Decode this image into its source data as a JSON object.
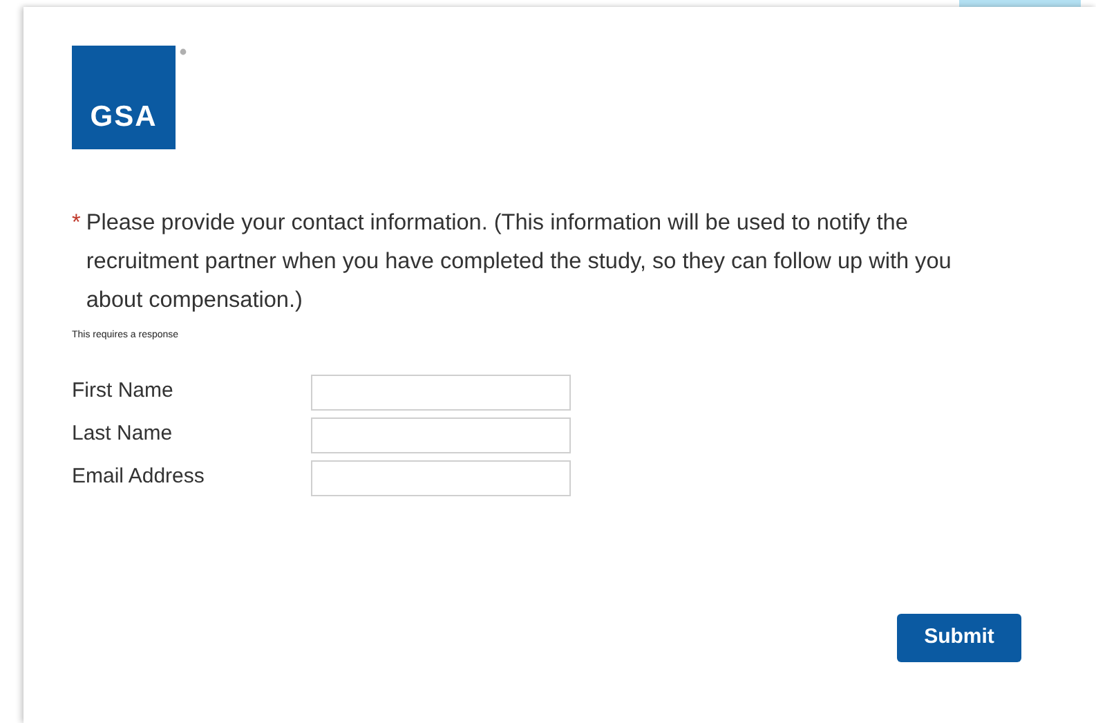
{
  "logo": {
    "text": "GSA"
  },
  "question": {
    "required": true,
    "required_mark": "*",
    "text": "Please provide your contact information. (This information will be used to notify the recruitment partner when you have completed the study, so they can follow up with you about compensation.)",
    "note": "This requires a response"
  },
  "fields": [
    {
      "label": "First Name"
    },
    {
      "label": "Last Name"
    },
    {
      "label": "Email Address"
    }
  ],
  "buttons": [
    {
      "label": "Submit"
    }
  ]
}
